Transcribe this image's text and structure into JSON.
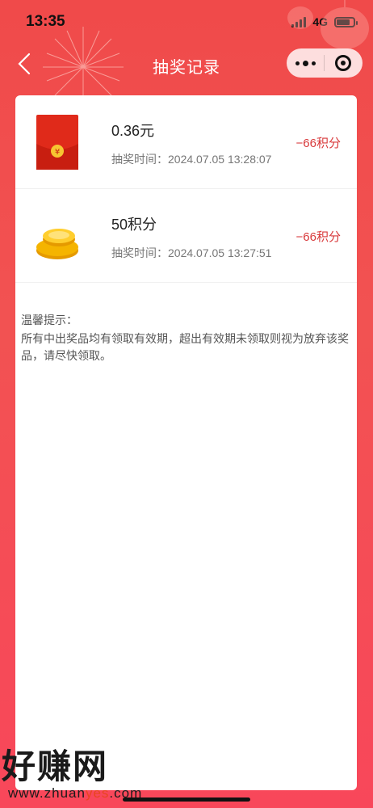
{
  "status_bar": {
    "time": "13:35",
    "network": "4G"
  },
  "nav": {
    "title": "抽奖记录",
    "back_icon": "chevron-left-icon",
    "more_icon": "more-dots-icon",
    "close_icon": "target-close-icon"
  },
  "records": [
    {
      "icon": "red-envelope-icon",
      "title": "0.36元",
      "time_label": "抽奖时间：",
      "time": "2024.07.05 13:28:07",
      "cost": "−66积分"
    },
    {
      "icon": "gold-coins-icon",
      "title": "50积分",
      "time_label": "抽奖时间：",
      "time": "2024.07.05 13:27:51",
      "cost": "−66积分"
    }
  ],
  "tips": {
    "title": "温馨提示：",
    "body": "所有中出奖品均有领取有效期，超出有效期未领取则视为放弃该奖品，请尽快领取。"
  },
  "watermark": {
    "main": "好赚网",
    "url_prefix": "www.zhuan",
    "url_highlight": "yes",
    "url_suffix": ".com"
  },
  "colors": {
    "header_red": "#f04a4a",
    "cost_red": "#d8383a",
    "envelope_red": "#e02a1a",
    "coin_gold": "#f5b400"
  }
}
